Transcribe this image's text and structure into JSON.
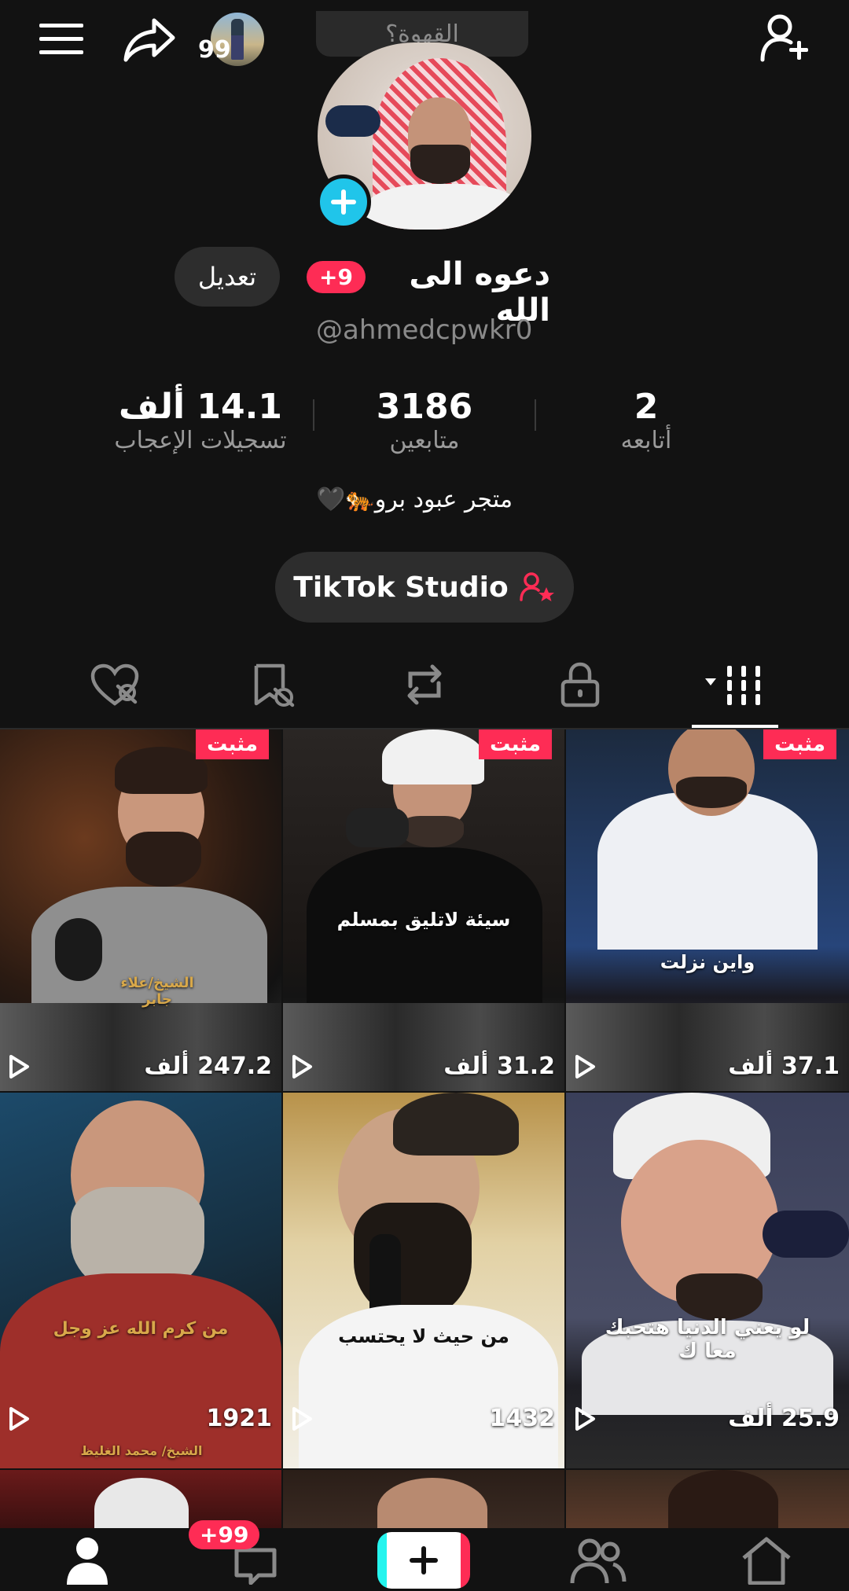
{
  "top": {
    "menu_icon": "hamburger-icon",
    "share_icon": "share-arrow-icon",
    "story_count": "99",
    "pill_text": "القهوة؟",
    "add_friend_icon": "add-user-icon"
  },
  "profile": {
    "name": "دعوه الى الله",
    "notif_badge": "+9",
    "edit_label": "تعديل",
    "handle": "@ahmedcpwkr0",
    "bio": "متجر عبود برو🐅🖤"
  },
  "stats": [
    {
      "value": "2",
      "label": "أتابعه"
    },
    {
      "value": "3186",
      "label": "متابعين"
    },
    {
      "value": "14.1 ألف",
      "label": "تسجيلات الإعجاب"
    }
  ],
  "studio": {
    "label": "TikTok Studio"
  },
  "tabs": [
    {
      "icon": "videos-grid-icon"
    },
    {
      "icon": "lock-icon"
    },
    {
      "icon": "repost-icon"
    },
    {
      "icon": "saved-hidden-icon"
    },
    {
      "icon": "liked-hidden-icon"
    }
  ],
  "videos": [
    {
      "pinned": "مثبت",
      "views": "37.1 ألف",
      "caption": "واين نزلت"
    },
    {
      "pinned": "مثبت",
      "views": "31.2 ألف",
      "caption": "سيئة لاتليق بمسلم"
    },
    {
      "pinned": "مثبت",
      "views": "247.2 ألف",
      "caption": "الشيخ/علاء جابر"
    },
    {
      "views": "25.9 ألف",
      "caption": "لو يعني الدنيا هتحبك معا ك"
    },
    {
      "views": "1432",
      "caption": "من حيث لا يحتسب"
    },
    {
      "views": "1921",
      "caption": "من كرم الله عز وجل",
      "credit": "الشيخ/ محمد الغليظ"
    }
  ],
  "nav": {
    "inbox_badge": "+99",
    "items": [
      "home-icon",
      "friends-icon",
      "create-icon",
      "inbox-icon",
      "profile-icon"
    ]
  },
  "colors": {
    "accent": "#fe2c55",
    "cyan": "#25f4ee",
    "bg": "#121212"
  }
}
